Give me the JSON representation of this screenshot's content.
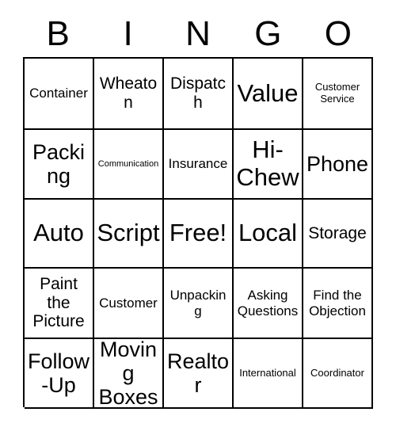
{
  "card": {
    "header_letters": [
      "B",
      "I",
      "N",
      "G",
      "O"
    ],
    "free_space_label": "Free!",
    "rows": [
      [
        {
          "label": "Container",
          "size": "sm"
        },
        {
          "label": "Wheaton",
          "size": "md"
        },
        {
          "label": "Dispatch",
          "size": "md"
        },
        {
          "label": "Value",
          "size": "xl"
        },
        {
          "label": "Customer Service",
          "size": "xs"
        }
      ],
      [
        {
          "label": "Packing",
          "size": "lg"
        },
        {
          "label": "Communication",
          "size": "xxs"
        },
        {
          "label": "Insurance",
          "size": "sm"
        },
        {
          "label": "Hi-Chew",
          "size": "xl"
        },
        {
          "label": "Phone",
          "size": "lg"
        }
      ],
      [
        {
          "label": "Auto",
          "size": "xl"
        },
        {
          "label": "Script",
          "size": "xl"
        },
        {
          "label": "Free!",
          "size": "xl"
        },
        {
          "label": "Local",
          "size": "xl"
        },
        {
          "label": "Storage",
          "size": "md"
        }
      ],
      [
        {
          "label": "Paint the Picture",
          "size": "md"
        },
        {
          "label": "Customer",
          "size": "sm"
        },
        {
          "label": "Unpacking",
          "size": "sm"
        },
        {
          "label": "Asking Questions",
          "size": "sm"
        },
        {
          "label": "Find the Objection",
          "size": "sm"
        }
      ],
      [
        {
          "label": "Follow-Up",
          "size": "lg"
        },
        {
          "label": "Moving Boxes",
          "size": "lg"
        },
        {
          "label": "Realtor",
          "size": "lg"
        },
        {
          "label": "International",
          "size": "xs"
        },
        {
          "label": "Coordinator",
          "size": "xs"
        }
      ]
    ]
  },
  "colors": {
    "background": "#ffffff",
    "text": "#000000",
    "grid_line": "#000000"
  }
}
